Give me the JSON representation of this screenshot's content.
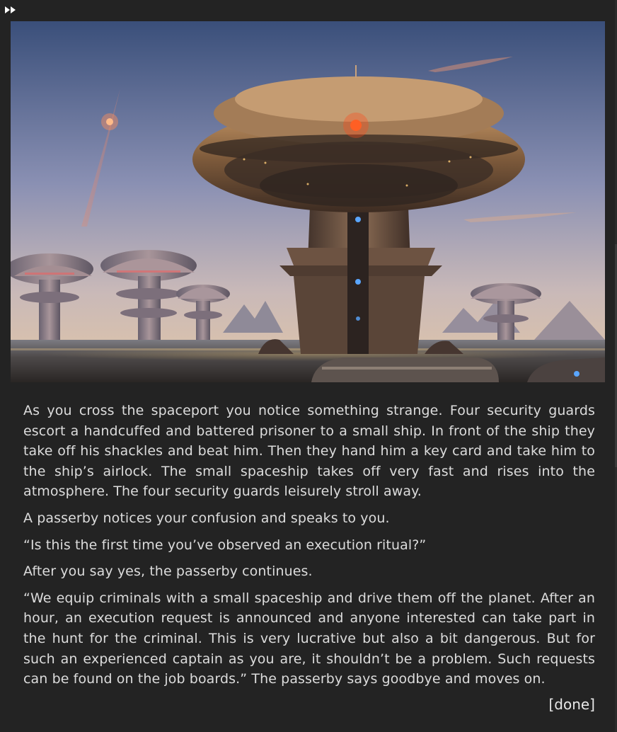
{
  "toolbar": {
    "fast_forward_icon": "fast-forward-icon"
  },
  "scene": {
    "description_icon": "spaceport-illustration"
  },
  "story": {
    "paragraphs": [
      "As you cross the spaceport you notice something strange. Four security guards escort a handcuffed and battered prisoner to a small ship. In front of the ship they take off his shackles and beat him. Then they hand him a key card and take him to the ship’s airlock. The small spaceship takes off very fast and rises into the atmosphere. The four security guards leisurely stroll away.",
      "A passerby notices your confusion and speaks to you.",
      "“Is this the first time you’ve observed an execution ritual?”",
      "After you say yes, the passerby continues.",
      "“We equip criminals with a small spaceship and drive them off the planet. After an hour, an execution request is announced and anyone interested can take part in the hunt for the criminal. This is very lucrative but also a bit dangerous. But for such an experienced captain as you are, it shouldn’t be a problem. Such requests can be found on the job boards.” The passerby says goodbye and moves on."
    ]
  },
  "actions": {
    "done_label": "[done]"
  },
  "colors": {
    "background": "#232323",
    "text": "#dcdcdc"
  }
}
